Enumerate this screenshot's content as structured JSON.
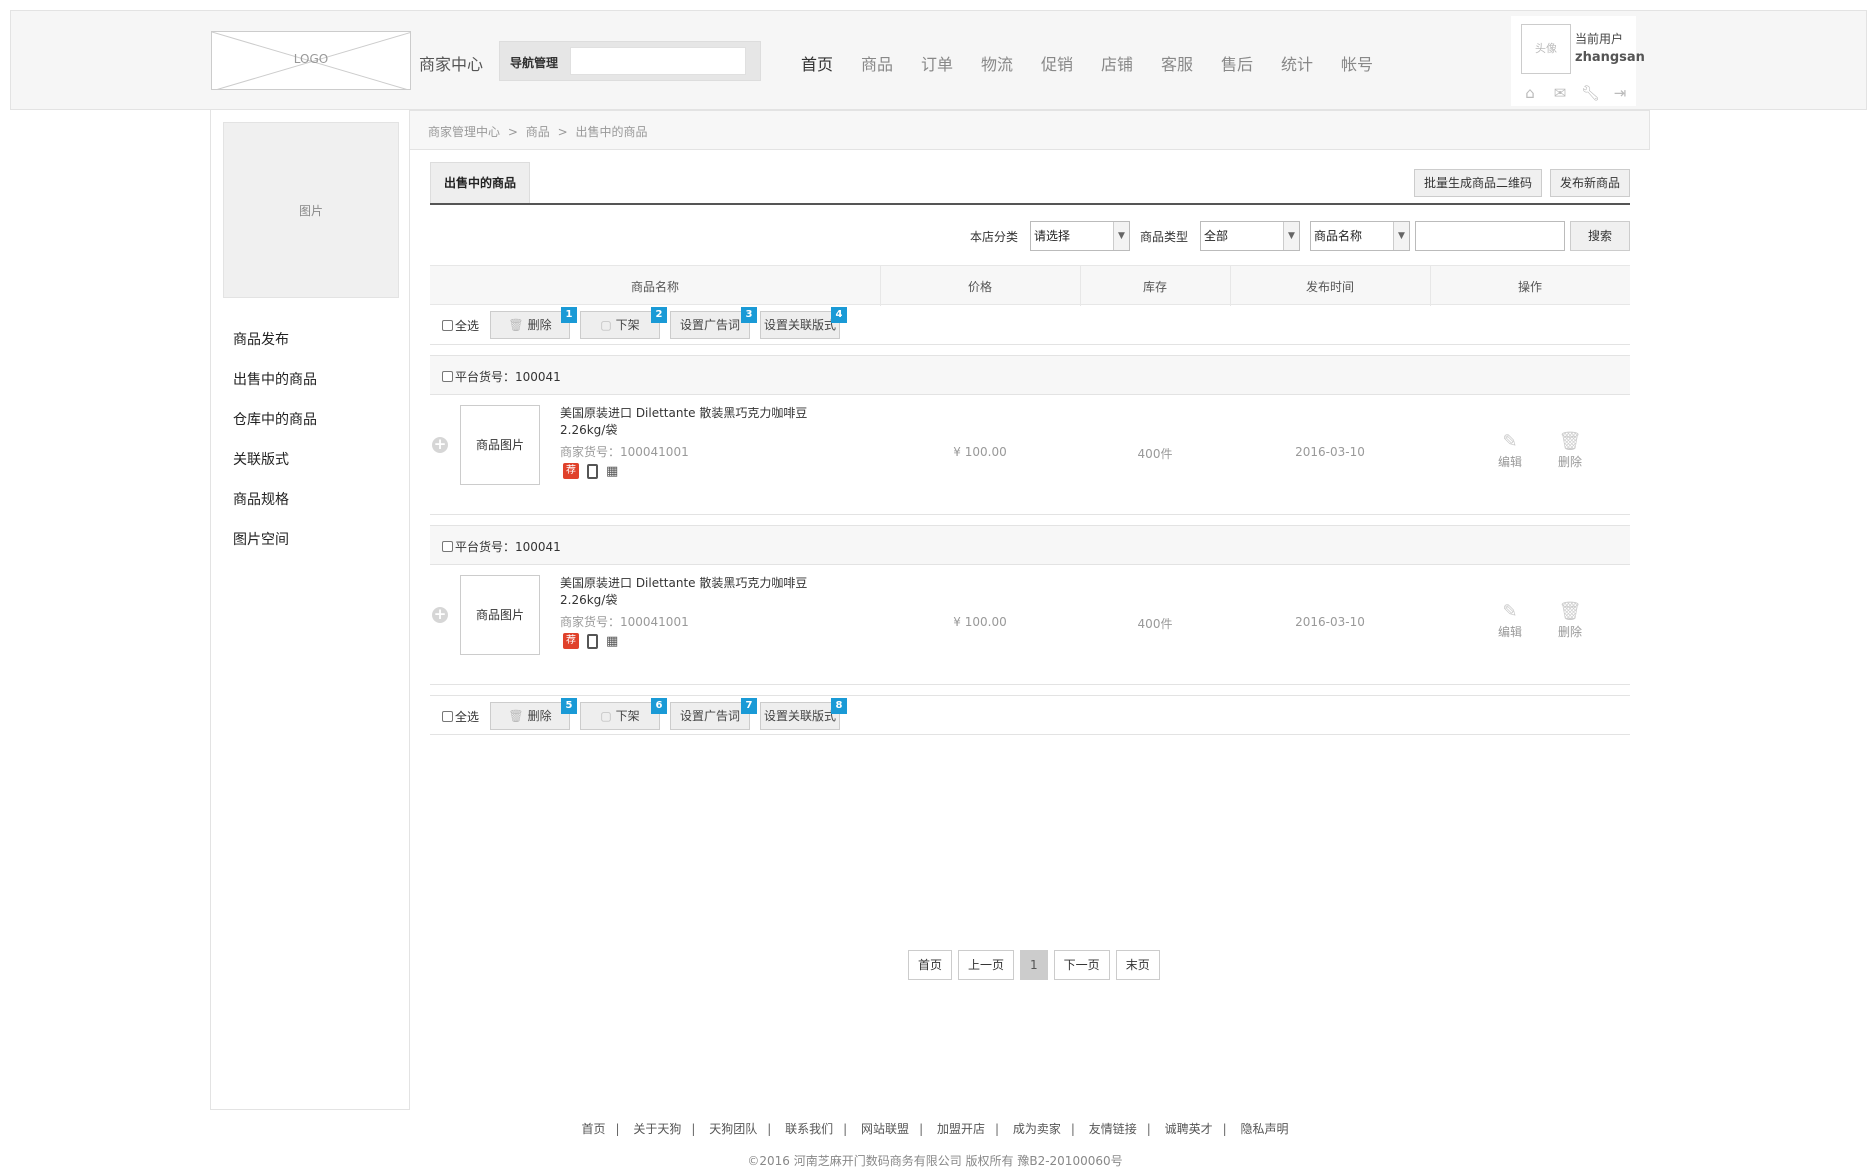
{
  "header": {
    "logo_text": "LOGO",
    "merchant_center": "商家中心",
    "nav_manage_label": "导航管理",
    "nav_items": [
      "首页",
      "商品",
      "订单",
      "物流",
      "促销",
      "店铺",
      "客服",
      "售后",
      "统计",
      "帐号"
    ],
    "active_nav": "首页",
    "avatar_text": "头像",
    "user_label": "当前用户",
    "user_name": "zhangsan",
    "user_icons": [
      "home-icon",
      "mail-icon",
      "wrench-icon",
      "logout-icon"
    ]
  },
  "sidebar": {
    "picture_text": "图片",
    "menu": [
      "商品发布",
      "出售中的商品",
      "仓库中的商品",
      "关联版式",
      "商品规格",
      "图片空间"
    ]
  },
  "breadcrumb": [
    "商家管理中心",
    ">",
    "商品",
    ">",
    "出售中的商品"
  ],
  "tabs": {
    "active": "出售中的商品",
    "batch_qr_label": "批量生成商品二维码",
    "publish_label": "发布新商品"
  },
  "filters": {
    "store_category_label": "本店分类",
    "store_category_value": "请选择",
    "goods_type_label": "商品类型",
    "goods_type_value": "全部",
    "search_field_value": "商品名称",
    "search_button": "搜索"
  },
  "table": {
    "headers": [
      "商品名称",
      "价格",
      "库存",
      "发布时间",
      "操作"
    ]
  },
  "batch_actions": {
    "select_all": "全选",
    "top_buttons": [
      {
        "label": "删除",
        "badge": "1"
      },
      {
        "label": "下架",
        "badge": "2"
      },
      {
        "label": "设置广告词",
        "badge": "3"
      },
      {
        "label": "设置关联版式",
        "badge": "4"
      }
    ],
    "bottom_buttons": [
      {
        "label": "删除",
        "badge": "5"
      },
      {
        "label": "下架",
        "badge": "6"
      },
      {
        "label": "设置广告词",
        "badge": "7"
      },
      {
        "label": "设置关联版式",
        "badge": "8"
      }
    ]
  },
  "products": [
    {
      "platform_code": "平台货号：100041",
      "image_text": "商品图片",
      "name": "美国原装进口 Dilettante 散装黑巧克力咖啡豆 2.26kg/袋",
      "merchant_code": "商家货号：100041001",
      "rec_tag": "荐",
      "price": "¥ 100.00",
      "stock": "400件",
      "publish_date": "2016-03-10",
      "edit_label": "编辑",
      "delete_label": "删除"
    },
    {
      "platform_code": "平台货号：100041",
      "image_text": "商品图片",
      "name": "美国原装进口 Dilettante 散装黑巧克力咖啡豆 2.26kg/袋",
      "merchant_code": "商家货号：100041001",
      "rec_tag": "荐",
      "price": "¥ 100.00",
      "stock": "400件",
      "publish_date": "2016-03-10",
      "edit_label": "编辑",
      "delete_label": "删除"
    }
  ],
  "pager": {
    "first": "首页",
    "prev": "上一页",
    "current": "1",
    "next": "下一页",
    "last": "末页"
  },
  "footer": {
    "links": [
      "首页",
      "关于天狗",
      "天狗团队",
      "联系我们",
      "网站联盟",
      "加盟开店",
      "成为卖家",
      "友情链接",
      "诚聘英才",
      "隐私声明"
    ],
    "copyright": "©2016 河南芝麻开门数码商务有限公司 版权所有 豫B2-20100060号"
  },
  "colors": {
    "badge": "#1a9ad6",
    "rec_tag": "#e0412b"
  }
}
